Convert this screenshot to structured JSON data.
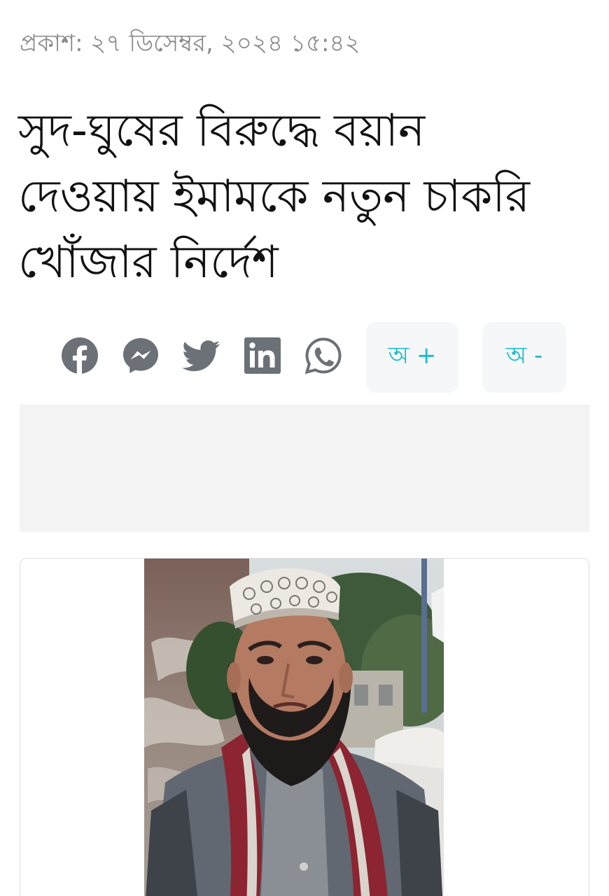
{
  "article": {
    "published": "প্রকাশ: ২৭ ডিসেম্বর, ২০২৪ ১৫:৪২",
    "headline": "সুদ-ঘুষের বিরুদ্ধে বয়ান দেওয়ায় ইমামকে নতুন চাকরি খোঁজার নির্দেশ"
  },
  "share": {
    "icons": [
      "facebook-icon",
      "messenger-icon",
      "twitter-icon",
      "linkedin-icon",
      "whatsapp-icon"
    ]
  },
  "font_controls": {
    "increase_label": "অ +",
    "decrease_label": "অ -"
  },
  "colors": {
    "icon_gray": "#6b7177",
    "accent_cyan": "#1bbccd",
    "meta_gray": "#8a8a8a",
    "headline": "#111111"
  }
}
